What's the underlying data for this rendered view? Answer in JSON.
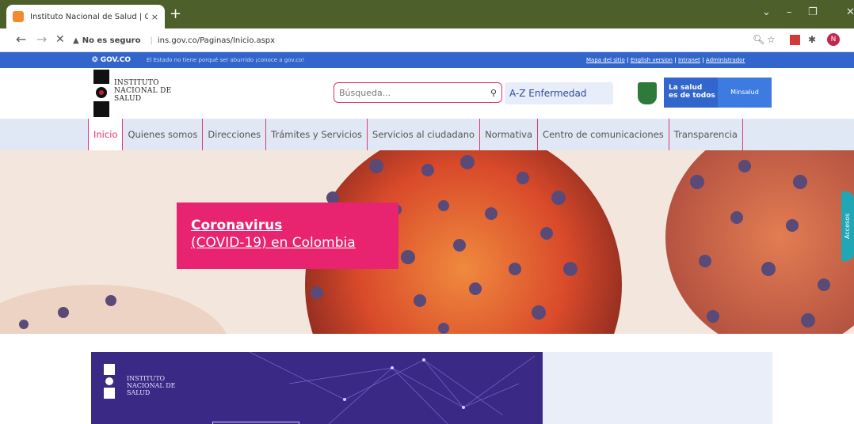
{
  "browser": {
    "tab_title": "Instituto Nacional de Salud | Col",
    "tab_close": "×",
    "new_tab": "+",
    "security_label": "No es seguro",
    "url": "ins.gov.co/Paginas/Inicio.aspx",
    "profile_initial": "N",
    "window_controls": [
      "⌄",
      "–",
      "❐",
      "✕"
    ]
  },
  "gov_bar": {
    "logo": "GOV.CO",
    "tagline": "El Estado no tiene porqué ser aburrido ¡conoce a gov.co!",
    "links": [
      "Mapa del sitio",
      "English version",
      "Intranet",
      "Administrador"
    ],
    "link_separator": "|"
  },
  "header": {
    "institution_name": [
      "INSTITUTO",
      "NACIONAL DE",
      "SALUD"
    ],
    "search_placeholder": "Búsqueda...",
    "az_link": "A-Z Enfermedad",
    "slogan": [
      "La salud",
      "es de todos"
    ],
    "ministry": "Minsalud"
  },
  "nav": {
    "items": [
      "Inicio",
      "Quienes somos",
      "Direcciones",
      "Trámites y Servicios",
      "Servicios al ciudadano",
      "Normativa",
      "Centro de comunicaciones",
      "Transparencia"
    ],
    "active": "Inicio"
  },
  "hero": {
    "headline": "Coronavirus",
    "subheadline": "(COVID-19) en Colombia",
    "accessibility_tab": "Accesos"
  },
  "banner": {
    "institution_name": [
      "INSTITUTO",
      "NACIONAL DE",
      "SALUD"
    ]
  },
  "colors": {
    "accent_pink": "#e8236f",
    "gov_blue": "#3366cc",
    "nav_bg": "#dfe8f4",
    "banner_purple": "#3a2a86"
  }
}
